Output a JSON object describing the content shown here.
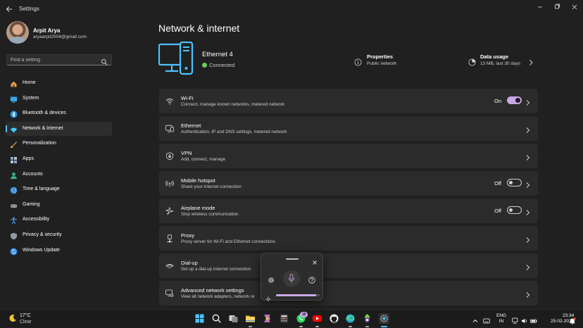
{
  "window": {
    "title": "Settings",
    "back_icon": "back-arrow-icon",
    "controls": [
      "minimize-icon",
      "maximize-icon",
      "close-icon"
    ]
  },
  "profile": {
    "name": "Arpit Arya",
    "email": "aryaarpit2004@gmail.com"
  },
  "search": {
    "placeholder": "Find a setting",
    "icon": "search-icon"
  },
  "nav": {
    "items": [
      {
        "label": "Home",
        "icon": "home-icon",
        "color": "#e8a24a"
      },
      {
        "label": "System",
        "icon": "system-icon",
        "color": "#3ba5e6"
      },
      {
        "label": "Bluetooth & devices",
        "icon": "bluetooth-icon",
        "color": "#1e8fe0"
      },
      {
        "label": "Network & internet",
        "icon": "network-icon",
        "color": "#4cc2ff",
        "active": true
      },
      {
        "label": "Personalization",
        "icon": "brush-icon",
        "color": "#e8924a"
      },
      {
        "label": "Apps",
        "icon": "apps-icon",
        "color": "#8aa4c8"
      },
      {
        "label": "Accounts",
        "icon": "accounts-icon",
        "color": "#3fb07a"
      },
      {
        "label": "Time & language",
        "icon": "globe-icon",
        "color": "#3a8fd8"
      },
      {
        "label": "Gaming",
        "icon": "gamepad-icon",
        "color": "#9aa0a6"
      },
      {
        "label": "Accessibility",
        "icon": "accessibility-icon",
        "color": "#4aa3ff"
      },
      {
        "label": "Privacy & security",
        "icon": "shield-icon",
        "color": "#8f9aa6"
      },
      {
        "label": "Windows Update",
        "icon": "update-icon",
        "color": "#2b8ce6"
      }
    ]
  },
  "page": {
    "title": "Network & internet"
  },
  "hero": {
    "connection_name": "Ethernet 4",
    "status": "Connected",
    "properties_title": "Properties",
    "properties_sub": "Public network",
    "usage_title": "Data usage",
    "usage_sub": "13 MB, last 30 days",
    "accent": "#4cc2ff"
  },
  "cards": [
    {
      "title": "Wi-Fi",
      "sub": "Connect, manage known networks, metered network",
      "icon": "wifi-icon",
      "state": "On",
      "toggle": "on"
    },
    {
      "title": "Ethernet",
      "sub": "Authentication, IP and DNS settings, metered network",
      "icon": "ethernet-icon"
    },
    {
      "title": "VPN",
      "sub": "Add, connect, manage",
      "icon": "vpn-shield-icon"
    },
    {
      "title": "Mobile hotspot",
      "sub": "Share your internet connection",
      "icon": "hotspot-icon",
      "state": "Off",
      "toggle": "off"
    },
    {
      "title": "Airplane mode",
      "sub": "Stop wireless communication",
      "icon": "airplane-icon",
      "state": "Off",
      "toggle": "off"
    },
    {
      "title": "Proxy",
      "sub": "Proxy server for Wi-Fi and Ethernet connections",
      "icon": "proxy-icon"
    },
    {
      "title": "Dial-up",
      "sub": "Set up a dial-up internet connection",
      "icon": "dialup-icon"
    },
    {
      "title": "Advanced network settings",
      "sub": "View all network adapters, network re",
      "icon": "advanced-network-icon"
    }
  ],
  "voice_panel": {
    "icons": [
      "grip-icon",
      "close-icon",
      "gear-icon",
      "microphone-icon",
      "help-icon",
      "brightness-icon"
    ],
    "level": 0.92
  },
  "taskbar": {
    "weather_temp": "17°C",
    "weather_cond": "Clear",
    "apps": [
      "start-icon",
      "search-icon",
      "task-view-icon",
      "file-explorer-icon",
      "copilot-icon",
      "calculator-icon",
      "whatsapp-icon",
      "youtube-icon",
      "github-icon",
      "edge-icon",
      "tor-icon",
      "settings-icon"
    ],
    "whatsapp_badge": "18",
    "lang_1": "ENG",
    "lang_2": "IN",
    "time": "23:34",
    "date": "25-02-2026"
  }
}
